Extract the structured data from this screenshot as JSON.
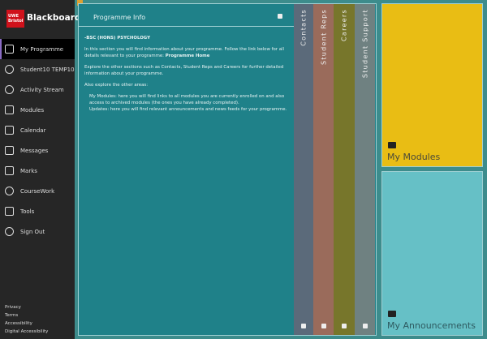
{
  "sidebar": {
    "brand": "Blackboard",
    "logo_text": "UWE Bristol",
    "items": [
      {
        "label": "My Programme",
        "icon": "layout-icon"
      },
      {
        "label": "Student10 TEMP10",
        "icon": "user-icon"
      },
      {
        "label": "Activity Stream",
        "icon": "globe-icon"
      },
      {
        "label": "Modules",
        "icon": "book-icon"
      },
      {
        "label": "Calendar",
        "icon": "calendar-icon"
      },
      {
        "label": "Messages",
        "icon": "envelope-icon"
      },
      {
        "label": "Marks",
        "icon": "marks-icon"
      },
      {
        "label": "CourseWork",
        "icon": "watch-icon"
      },
      {
        "label": "Tools",
        "icon": "edit-icon"
      },
      {
        "label": "Sign Out",
        "icon": "sign-out-icon"
      }
    ],
    "footer": [
      "Privacy",
      "Terms",
      "Accessibility",
      "Digital Accessibility"
    ]
  },
  "programme": {
    "title": "Programme Info",
    "heading": "-BSC (HONS) PSYCHOLOGY",
    "p1": "In this section you will find information about your programme. Follow the link below for all details relevant to your programme: ",
    "p1_link": "Programme Home",
    "p2": "Explore the other sections such as Contacts, Student Reps and Careers for further detailed information about your programme.",
    "p3": "Also explore the other areas:",
    "p4": "My Modules: here you will find links to all modules you are currently enrolled on and also access to archived modules (the ones you have already completed).",
    "p5": "Updates: here you will find relevant announcements and news feeds for your programme."
  },
  "tabs": [
    {
      "label": "Contacts",
      "color": "#5b6a7a"
    },
    {
      "label": "Student Reps",
      "color": "#9a6b5b"
    },
    {
      "label": "Careers",
      "color": "#77762b"
    },
    {
      "label": "Student Support",
      "color": "#6f8181"
    }
  ],
  "tiles": [
    {
      "label": "My Modules",
      "color": "#e9bd14",
      "icon": "modules-icon"
    },
    {
      "label": "My Announcements",
      "color": "#66c0c6",
      "icon": "coffee-icon"
    }
  ]
}
